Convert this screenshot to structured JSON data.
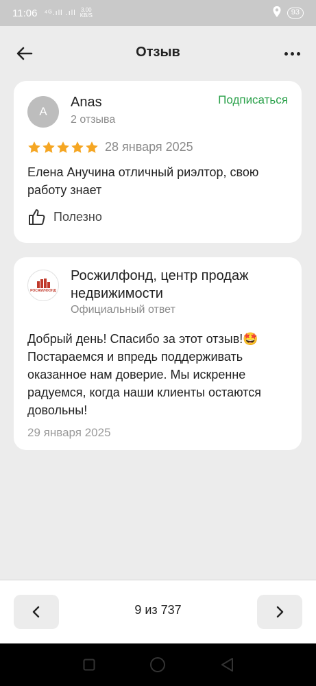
{
  "status_bar": {
    "time": "11:06",
    "signal": "⁴ᴳ.ıll .ıll",
    "speed_value": "3.00",
    "speed_unit": "KB/S",
    "battery": "93"
  },
  "header": {
    "title": "Отзыв"
  },
  "review": {
    "avatar_letter": "A",
    "author": "Anas",
    "author_reviews": "2 отзыва",
    "subscribe_label": "Подписаться",
    "rating": 5,
    "rating_max": 5,
    "date": "28 января 2025",
    "text": "Елена Анучина отличный риэлтор, свою работу знает",
    "useful_label": "Полезно"
  },
  "answer": {
    "logo_text": "РОСЖИЛФОНД",
    "org_name": "Росжилфонд, центр продаж недвижимости",
    "org_sub": "Официальный ответ",
    "text": "Добрый день! Спасибо за этот отзыв!🤩 Постараемся и впредь поддерживать оказанное нам доверие. Мы искренне радуемся, когда наши клиенты остаются довольны!",
    "date": "29 января 2025"
  },
  "pager": {
    "text": "9 из 737"
  },
  "colors": {
    "accent_green": "#2aa14a",
    "star": "#f5a623",
    "background": "#ececec",
    "card": "#ffffff"
  },
  "icons": {
    "back": "arrow-left-icon",
    "more": "more-dots-icon",
    "star": "star-icon",
    "useful": "thumbs-up-icon",
    "prev": "chevron-left-icon",
    "next": "chevron-right-icon"
  }
}
